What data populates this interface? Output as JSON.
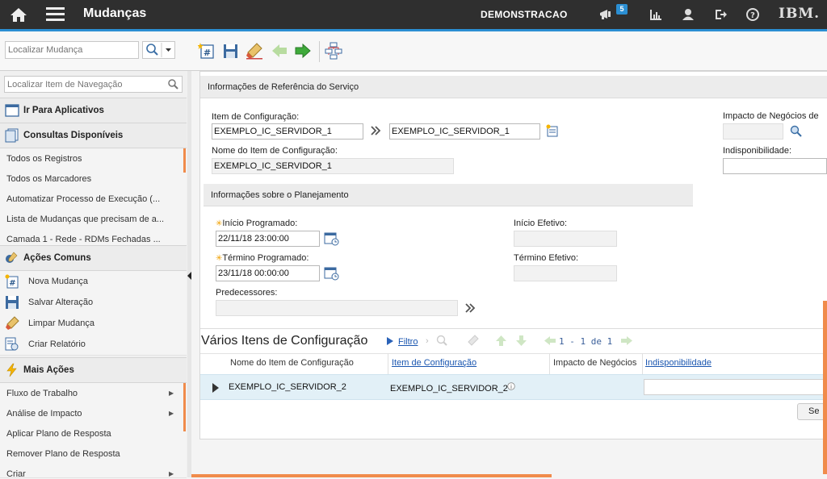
{
  "header": {
    "title": "Mudanças",
    "environment": "DEMONSTRACAO",
    "notification_count": "5",
    "logo": "IBM."
  },
  "toolbar": {
    "search_placeholder": "Localizar Mudança",
    "icons": [
      "new-record-icon",
      "save-icon",
      "clear-icon",
      "previous-icon",
      "next-icon",
      "workflow-icon"
    ]
  },
  "sidebar": {
    "search_placeholder": "Localizar Item de Navegação",
    "go_to_apps": "Ir Para Aplicativos",
    "available_queries": "Consultas Disponíveis",
    "queries": [
      "Todos os Registros",
      "Todos os Marcadores",
      "Automatizar Processo de Execução (...",
      "Lista de Mudanças que precisam de a...",
      "Camada 1 - Rede - RDMs Fechadas ..."
    ],
    "common_actions": "Ações Comuns",
    "actions": [
      "Nova Mudança",
      "Salvar Alteração",
      "Limpar Mudança",
      "Criar Relatório"
    ],
    "more_actions": "Mais Ações",
    "more": [
      "Fluxo de Trabalho",
      "Análise de Impacto",
      "Aplicar Plano de Resposta",
      "Remover Plano de Resposta",
      "Criar"
    ]
  },
  "service_ref": {
    "title": "Informações de Referência do Serviço",
    "ci_label": "Item de Configuração:",
    "ci_value": "EXEMPLO_IC_SERVIDOR_1",
    "ci_value2": "EXEMPLO_IC_SERVIDOR_1",
    "ci_name_label": "Nome do Item de Configuração:",
    "ci_name_value": "EXEMPLO_IC_SERVIDOR_1",
    "business_impact_label": "Impacto de Negócios de",
    "unavailability_label": "Indisponibilidade:"
  },
  "planning": {
    "title": "Informações sobre o Planejamento",
    "sched_start_label": "Início Programado:",
    "sched_start_value": "22/11/18 23:00:00",
    "sched_end_label": "Término Programado:",
    "sched_end_value": "23/11/18 00:00:00",
    "predecessors_label": "Predecessores:",
    "actual_start_label": "Início Efetivo:",
    "actual_end_label": "Término Efetivo:"
  },
  "ci_table": {
    "title": "Vários Itens de Configuração",
    "filter": "Filtro",
    "pagination": "1 - 1 de 1",
    "columns": [
      "Nome do Item de Configuração",
      "Item de Configuração",
      "Impacto de Negócios",
      "Indisponibilidade"
    ],
    "rows": [
      {
        "name": "EXEMPLO_IC_SERVIDOR_2",
        "ci": "EXEMPLO_IC_SERVIDOR_2",
        "impact": "",
        "unavailability": ""
      }
    ],
    "select_button": "Se"
  }
}
